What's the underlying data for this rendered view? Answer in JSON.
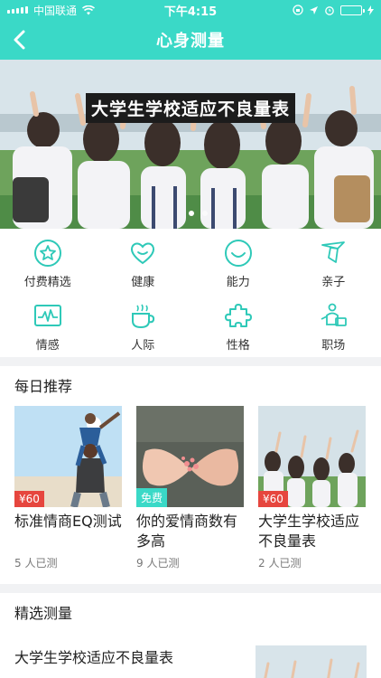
{
  "status": {
    "carrier": "中国联通",
    "time": "下午4:15",
    "battery_color": "#7cff4d",
    "accent": "#3ad9c7"
  },
  "nav": {
    "title": "心身测量",
    "back_icon": "chevron-left-icon"
  },
  "banner": {
    "title": "大学生学校适应不良量表"
  },
  "categories": [
    {
      "label": "付费精选",
      "icon": "star-circle-icon"
    },
    {
      "label": "健康",
      "icon": "heart-icon"
    },
    {
      "label": "能力",
      "icon": "smile-icon"
    },
    {
      "label": "亲子",
      "icon": "necktie-icon"
    },
    {
      "label": "情感",
      "icon": "heartbeat-monitor-icon"
    },
    {
      "label": "人际",
      "icon": "coffee-cup-icon"
    },
    {
      "label": "性格",
      "icon": "puzzle-icon"
    },
    {
      "label": "职场",
      "icon": "briefcase-person-icon"
    }
  ],
  "daily": {
    "section_title": "每日推荐",
    "cards": [
      {
        "title": "标准情商EQ测试",
        "price": "¥60",
        "price_color": "#e6463e",
        "count": "5 人已测"
      },
      {
        "title": "你的爱情商数有多高",
        "price": "免费",
        "price_color": "#3ad9c7",
        "count": "9 人已测"
      },
      {
        "title": "大学生学校适应不良量表",
        "price": "¥60",
        "price_color": "#e6463e",
        "count": "2 人已测"
      }
    ]
  },
  "featured": {
    "section_title": "精选测量",
    "first_item_title": "大学生学校适应不良量表"
  }
}
